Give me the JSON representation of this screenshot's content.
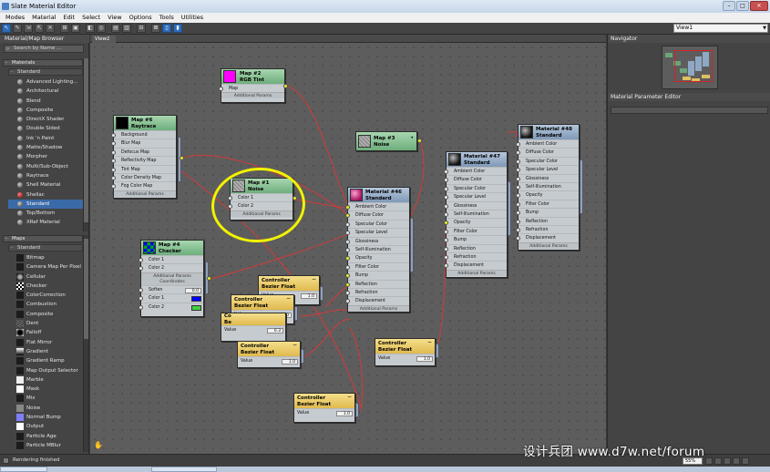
{
  "window": {
    "title": "Slate Material Editor",
    "minimize": "–",
    "maximize": "□",
    "close": "✕"
  },
  "menu": [
    "Modes",
    "Material",
    "Edit",
    "Select",
    "View",
    "Options",
    "Tools",
    "Utilities"
  ],
  "toolbar": {
    "view_select": "View1"
  },
  "browser": {
    "title": "Material/Map Browser",
    "search_placeholder": "Search by Name ...",
    "materials_label": "Materials",
    "standard_label": "Standard",
    "materials": [
      "Advanced Lighting...",
      "Architectural",
      "Blend",
      "Composite",
      "DirectX Shader",
      "Double Sided",
      "Ink 'n Paint",
      "Matte/Shadow",
      "Morpher",
      "Multi/Sub-Object",
      "Raytrace",
      "Shell Material",
      "Shellac",
      "Standard",
      "Top/Bottom",
      "XRef Material"
    ],
    "selected_material": "Standard",
    "maps_label": "Maps",
    "maps_standard_label": "Standard",
    "maps": [
      "Bitmap",
      "Camera Map Per Pixel",
      "Cellular",
      "Checker",
      "ColorCorrection",
      "Combustion",
      "Composite",
      "Dent",
      "Falloff",
      "Flat Mirror",
      "Gradient",
      "Gradient Ramp",
      "Map Output Selector",
      "Marble",
      "Mask",
      "Mix",
      "Noise",
      "Normal Bump",
      "Output",
      "Particle Age",
      "Particle MBlur"
    ]
  },
  "view": {
    "tab": "View1",
    "corner_icon": "hand-icon"
  },
  "nodes": {
    "map2": {
      "name": "Map #2",
      "type": "RGB Tint",
      "slots": [
        "Map"
      ],
      "footer": "Additional Params"
    },
    "map6": {
      "name": "Map #6",
      "type": "Raytrace",
      "slots": [
        "Background",
        "Blur Map",
        "Defocus Map",
        "Reflectivity Map",
        "Tint Map",
        "Color Density Map",
        "Fog Color Map"
      ],
      "footer": "Additional Params"
    },
    "map3": {
      "name": "Map #3",
      "type": "Noise"
    },
    "map1": {
      "name": "Map #1",
      "type": "Noise",
      "slots": [
        "Color 1",
        "Color 2"
      ],
      "footer": "Additional Params"
    },
    "mat46": {
      "name": "Material #46",
      "type": "Standard",
      "slots": [
        "Ambient Color",
        "Diffuse Color",
        "Specular Color",
        "Specular Level",
        "Glossiness",
        "Self-Illumination",
        "Opacity",
        "Filter Color",
        "Bump",
        "Reflection",
        "Refraction",
        "Displacement"
      ],
      "footer": "Additional Params"
    },
    "mat47": {
      "name": "Material #47",
      "type": "Standard",
      "slots": [
        "Ambient Color",
        "Diffuse Color",
        "Specular Color",
        "Specular Level",
        "Glossiness",
        "Self-Illumination",
        "Opacity",
        "Filter Color",
        "Bump",
        "Reflection",
        "Refraction",
        "Displacement"
      ],
      "footer": "Additional Params"
    },
    "mat48": {
      "name": "Material #48",
      "type": "Standard",
      "slots": [
        "Ambient Color",
        "Diffuse Color",
        "Specular Color",
        "Specular Level",
        "Glossiness",
        "Self-Illumination",
        "Opacity",
        "Filter Color",
        "Bump",
        "Reflection",
        "Refraction",
        "Displacement"
      ],
      "footer": "Additional Params"
    },
    "map4": {
      "name": "Map #4",
      "type": "Checker",
      "slots": [
        "Color 1",
        "Color 2"
      ],
      "footer": "Additional Params",
      "coord": "Coordinates",
      "soften_label": "Soften",
      "soften_value": "0.0",
      "color1_label": "Color 1",
      "color2_label": "Color 2",
      "color1": "#0000ff",
      "color2": "#40d040"
    },
    "ctrl_a": {
      "name": "Controller",
      "type": "Bezier Float",
      "value_label": "Value",
      "value": "1.0"
    },
    "ctrl_b": {
      "name": "Controller",
      "type": "Bezier Float",
      "value_label": "Value",
      "value": "1.0"
    },
    "ctrl_c": {
      "name": "Co",
      "type": "Be",
      "value_label": "Value",
      "value": "0.3"
    },
    "ctrl_d": {
      "name": "Controller",
      "type": "Bezier Float",
      "value_label": "Value",
      "value": "1.0"
    },
    "ctrl_e": {
      "name": "Controller",
      "type": "Bezier Float",
      "value_label": "Value",
      "value": "1.0"
    },
    "ctrl_f": {
      "name": "Controller",
      "type": "Bezier Float",
      "value_label": "Value",
      "value": "1.0"
    }
  },
  "navigator": {
    "title": "Navigator"
  },
  "params": {
    "title": "Material Parameter Editor"
  },
  "status": {
    "text": "Rendering finished",
    "zoom": "55%"
  },
  "watermark": "设计兵团 www.d7w.net/forum",
  "colors": {
    "wire": "#d23a3a",
    "highlight": "#f2f200",
    "selection": "#3b6aa8"
  }
}
